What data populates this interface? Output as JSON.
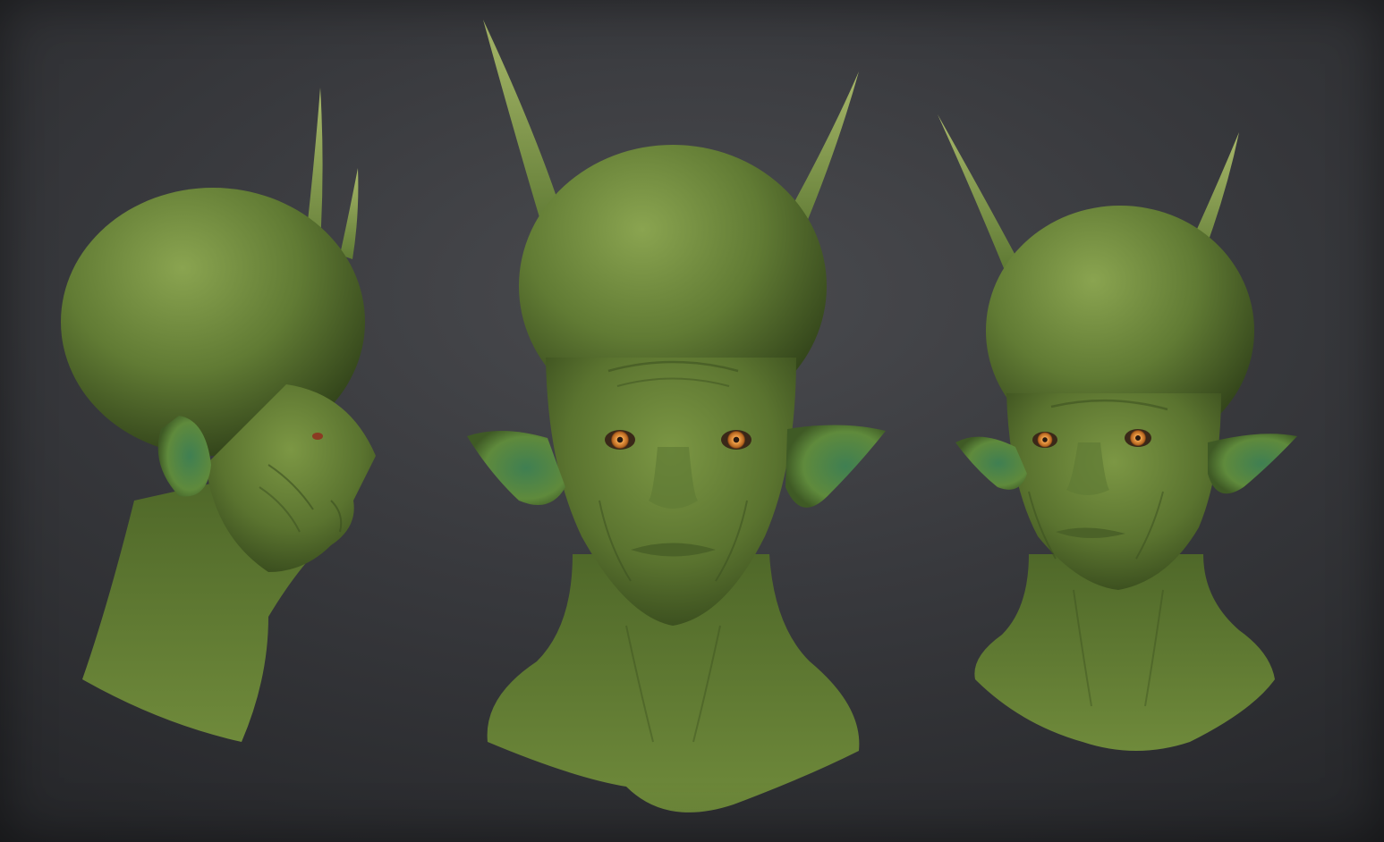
{
  "scene": {
    "description_free": true,
    "views": [
      {
        "id": "side-view",
        "orientation": "profile"
      },
      {
        "id": "front-view",
        "orientation": "front"
      },
      {
        "id": "three-quarter-view",
        "orientation": "three-quarter"
      }
    ]
  },
  "colors": {
    "background_center": "#4a4b4f",
    "background_edge": "#242528",
    "skin_light": "#7f9a48",
    "skin_mid": "#5f7a34",
    "skin_dark": "#3a4e1f",
    "ear_inner": "#4f8a4c",
    "iris": "#d98a2b",
    "pupil": "#2a1a10"
  }
}
